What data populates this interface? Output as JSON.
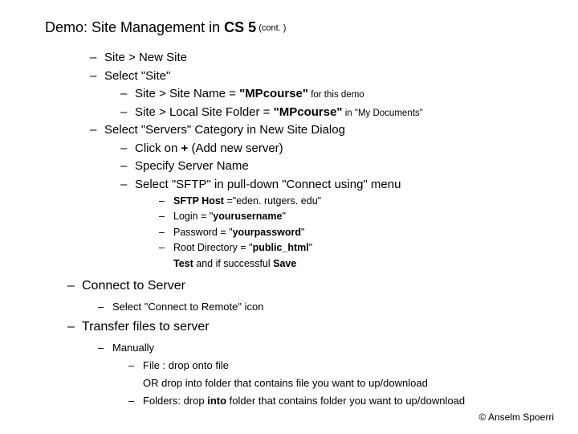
{
  "title": {
    "prefix": "Demo: Site Management in ",
    "bold": "CS 5",
    "suffix": " (cont. )"
  },
  "l": {
    "a": "Site > New Site",
    "b": "Select \"Site\"",
    "c1a": "Site > Site Name = ",
    "c1b": "\"MPcourse\"",
    "c1c": " for this demo",
    "c2a": "Site > Local Site Folder = ",
    "c2b": "\"MPcourse\"",
    "c2c": " in \"My Documents\"",
    "d": "Select \"Servers\" Category in New Site Dialog",
    "e1a": "Click on ",
    "e1b": "+",
    "e1c": " (Add new server)",
    "e2": "Specify Server Name",
    "e3": "Select \"SFTP\" in pull-down \"Connect using\" menu",
    "f1a": "SFTP Host ",
    "f1b": "=\"eden. rutgers. edu\"",
    "f2a": "Login = \"",
    "f2b": "yourusername",
    "f2c": "\"",
    "f3a": "Password = \"",
    "f3b": "yourpassword",
    "f3c": "\"",
    "f4a": "Root Directory = \"",
    "f4b": "public_html",
    "f4c": "\"",
    "f5a": "Test",
    "f5b": " and if successful ",
    "f5c": "Save",
    "g": "Connect to Server",
    "g1": "Select \"Connect to Remote\" icon",
    "h": "Transfer files to server",
    "h1": "Manually",
    "h2a": "File : drop onto file",
    "h2b": "OR drop into folder that contains file you want to up/download",
    "h3a": "Folders: drop ",
    "h3b": "into",
    "h3c": " folder that contains folder you want to up/download"
  },
  "copyright": "© Anselm Spoerri"
}
